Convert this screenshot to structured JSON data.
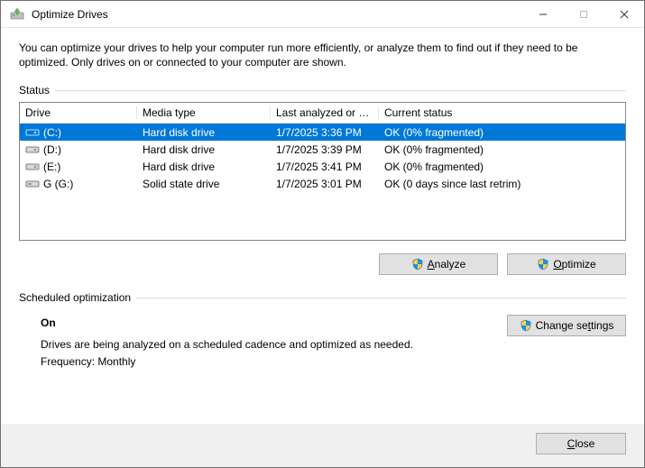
{
  "window": {
    "title": "Optimize Drives"
  },
  "intro": "You can optimize your drives to help your computer run more efficiently, or analyze them to find out if they need to be optimized. Only drives on or connected to your computer are shown.",
  "status_section_label": "Status",
  "columns": {
    "drive": "Drive",
    "media": "Media type",
    "last": "Last analyzed or o...",
    "status": "Current status"
  },
  "drives": [
    {
      "name": "(C:)",
      "media": "Hard disk drive",
      "last": "1/7/2025 3:36 PM",
      "status": "OK (0% fragmented)",
      "selected": true,
      "kind": "hdd"
    },
    {
      "name": "(D:)",
      "media": "Hard disk drive",
      "last": "1/7/2025 3:39 PM",
      "status": "OK (0% fragmented)",
      "selected": false,
      "kind": "hdd"
    },
    {
      "name": "(E:)",
      "media": "Hard disk drive",
      "last": "1/7/2025 3:41 PM",
      "status": "OK (0% fragmented)",
      "selected": false,
      "kind": "hdd"
    },
    {
      "name": "G (G:)",
      "media": "Solid state drive",
      "last": "1/7/2025 3:01 PM",
      "status": "OK (0 days since last retrim)",
      "selected": false,
      "kind": "ssd"
    }
  ],
  "buttons": {
    "analyze_prefix": "A",
    "analyze_rest": "nalyze",
    "optimize_prefix": "O",
    "optimize_rest": "ptimize",
    "change_prefix": "Change se",
    "change_underline": "t",
    "change_rest": "tings",
    "close_prefix": "C",
    "close_rest": "lose"
  },
  "schedule": {
    "section_label": "Scheduled optimization",
    "state": "On",
    "desc": "Drives are being analyzed on a scheduled cadence and optimized as needed.",
    "freq": "Frequency: Monthly"
  }
}
